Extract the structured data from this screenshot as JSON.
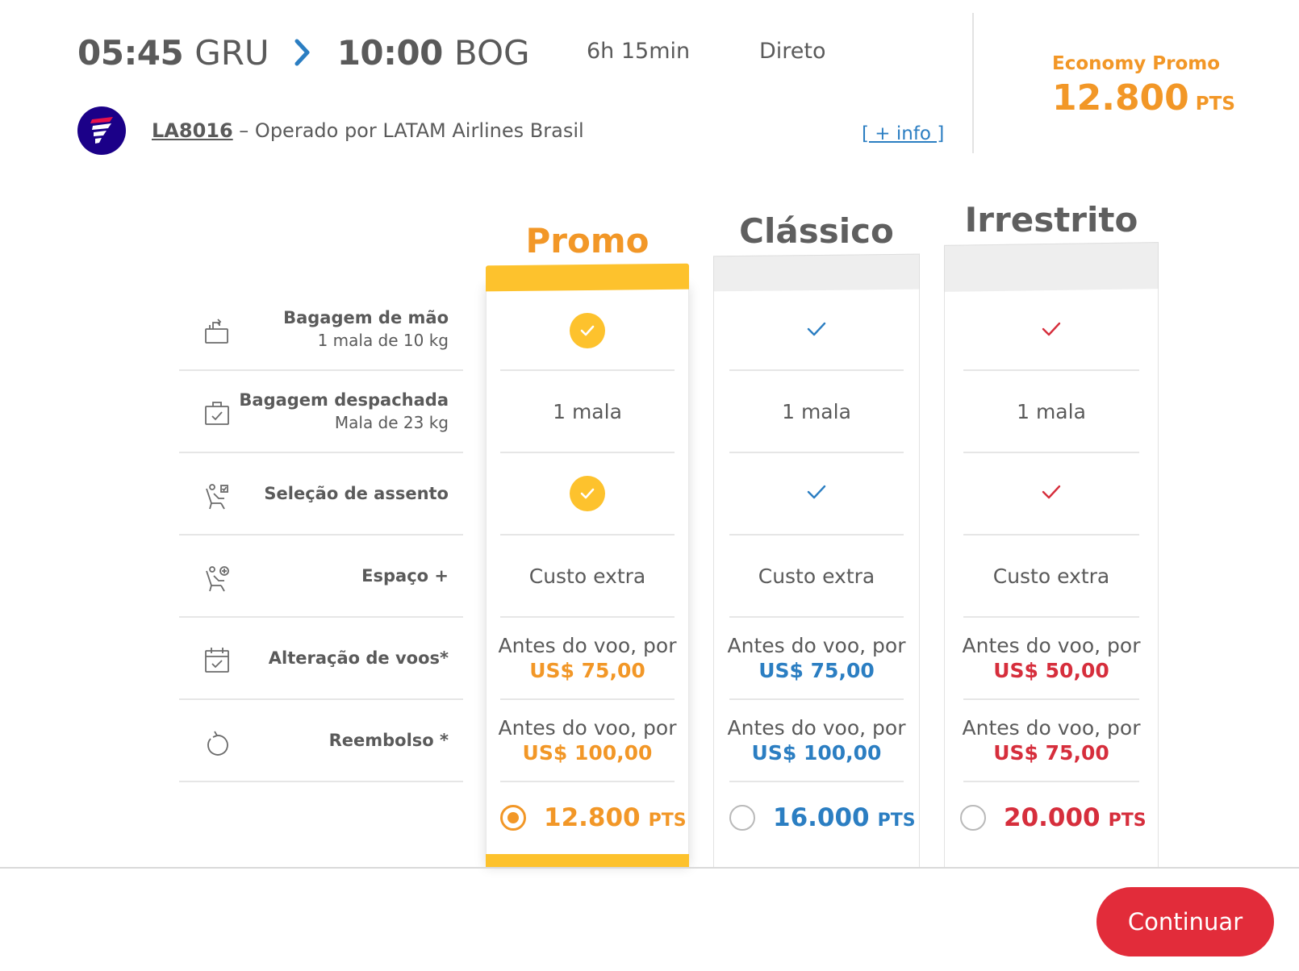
{
  "flight": {
    "departure_time": "05:45",
    "departure_airport": "GRU",
    "arrival_time": "10:00",
    "arrival_airport": "BOG",
    "duration": "6h 15min",
    "stops": "Direto",
    "flight_number": "LA8016",
    "operator": " – Operado por LATAM Airlines Brasil",
    "info_link": "[ + info ]",
    "cabin": "Economy Promo",
    "price_points": "12.800",
    "price_unit": "PTS"
  },
  "icons": {
    "arrow": "chevron-right-icon",
    "logo": "latam-logo",
    "features": [
      "carry-on-bag-icon",
      "checked-bag-icon",
      "seat-selection-icon",
      "extra-space-seat-icon",
      "calendar-change-icon",
      "refund-icon"
    ]
  },
  "colors": {
    "promo": "#f29727",
    "promo_yellow": "#fdc22d",
    "classico": "#2b7ec2",
    "irrestrito": "#d62e3c",
    "continue_button": "#e22c3a"
  },
  "features": [
    {
      "title": "Bagagem de mão",
      "subtitle": "1 mala de 10 kg"
    },
    {
      "title": "Bagagem despachada",
      "subtitle": "Mala de 23 kg"
    },
    {
      "title": "Seleção de assento",
      "subtitle": ""
    },
    {
      "title": "Espaço +",
      "subtitle": ""
    },
    {
      "title": "Alteração de voos*",
      "subtitle": ""
    },
    {
      "title": "Reembolso *",
      "subtitle": ""
    }
  ],
  "fares": [
    {
      "name": "Promo",
      "selected": true,
      "carry_on": "check",
      "checked_bag": "1 mala",
      "seat_selection": "check",
      "extra_space": "Custo extra",
      "change_text": "Antes do voo, por",
      "change_price": "US$ 75,00",
      "refund_text": "Antes do voo, por",
      "refund_price": "US$ 100,00",
      "points": "12.800",
      "points_unit": "PTS"
    },
    {
      "name": "Clássico",
      "selected": false,
      "carry_on": "check",
      "checked_bag": "1 mala",
      "seat_selection": "check",
      "extra_space": "Custo extra",
      "change_text": "Antes do voo, por",
      "change_price": "US$ 75,00",
      "refund_text": "Antes do voo, por",
      "refund_price": "US$ 100,00",
      "points": "16.000",
      "points_unit": "PTS"
    },
    {
      "name": "Irrestrito",
      "selected": false,
      "carry_on": "check",
      "checked_bag": "1 mala",
      "seat_selection": "check",
      "extra_space": "Custo extra",
      "change_text": "Antes do voo, por",
      "change_price": "US$ 50,00",
      "refund_text": "Antes do voo, por",
      "refund_price": "US$ 75,00",
      "points": "20.000",
      "points_unit": "PTS"
    }
  ],
  "actions": {
    "continue_label": "Continuar"
  }
}
